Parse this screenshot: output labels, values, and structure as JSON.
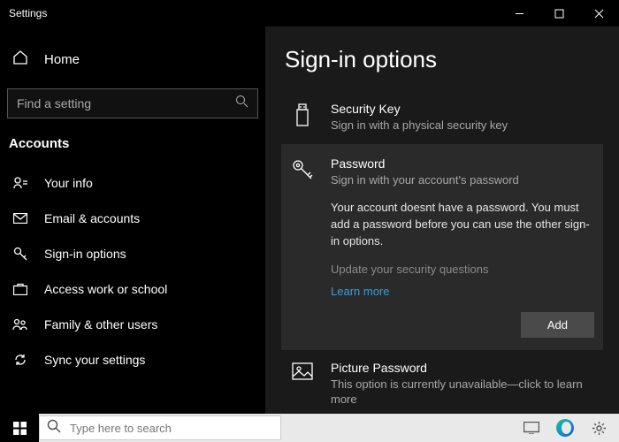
{
  "window": {
    "title": "Settings"
  },
  "sidebar": {
    "home": "Home",
    "search_placeholder": "Find a setting",
    "section": "Accounts",
    "items": [
      {
        "label": "Your info"
      },
      {
        "label": "Email & accounts"
      },
      {
        "label": "Sign-in options"
      },
      {
        "label": "Access work or school"
      },
      {
        "label": "Family & other users"
      },
      {
        "label": "Sync your settings"
      }
    ]
  },
  "main": {
    "heading": "Sign-in options",
    "options": [
      {
        "title": "Security Key",
        "desc": "Sign in with a physical security key"
      },
      {
        "title": "Password",
        "desc": "Sign in with your account's password",
        "message": "Your account doesnt have a password. You must add a password before you can use the other sign-in options.",
        "security_questions": "Update your security questions",
        "learn_more": "Learn more",
        "add_button": "Add"
      },
      {
        "title": "Picture Password",
        "desc": "This option is currently unavailable—click to learn more"
      }
    ]
  },
  "taskbar": {
    "search_placeholder": "Type here to search"
  }
}
